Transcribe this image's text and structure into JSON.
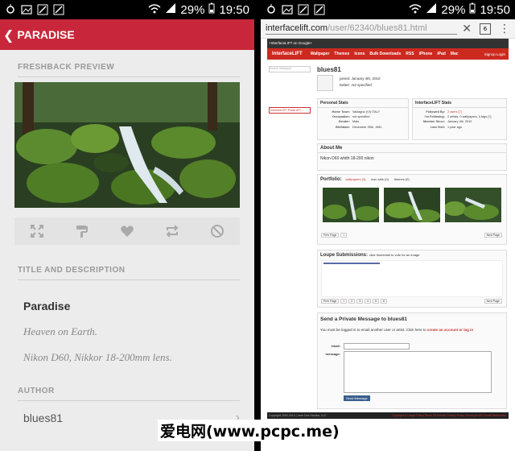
{
  "status": {
    "battery_pct": "29%",
    "time": "19:50"
  },
  "left": {
    "header": {
      "title": "PARADISE"
    },
    "preview_label": "FRESHBACK PREVIEW",
    "title_label": "TITLE AND DESCRIPTION",
    "title": "Paradise",
    "description1": "Heaven on Earth.",
    "description2": "Nikon D60, Nikkor 18-200mm lens.",
    "author_label": "AUTHOR",
    "author": "blues81",
    "accent_color": "#c8273b",
    "actions": [
      "expand-icon",
      "paint-roller-icon",
      "heart-icon",
      "repeat-icon",
      "block-icon"
    ]
  },
  "right": {
    "url_domain": "interfacelift.com",
    "url_path": "/user/62340/blues81.html",
    "tab_count": "6",
    "site": {
      "gbar": "+InterfaceLIFT on Google+",
      "logo": "InterfaceLIFT",
      "nav": [
        "Wallpaper",
        "Themes",
        "Icons",
        "Bulk Downloads",
        "RSS",
        "iPhone",
        "iPad",
        "Mac"
      ],
      "nav_right": "Signup  Login",
      "search_placeholder": "Search Wallpaper",
      "public_api": "InterfaceLIFT Public API →",
      "username": "blues81",
      "joined_label": "joined:",
      "joined": "January 4th, 2010",
      "twitter_label": "twitter:",
      "twitter": "not specified",
      "personal_stats_title": "Personal Stats",
      "personal_stats": [
        {
          "k": "Home Town:",
          "v": "Valdagno (VI) ITALY"
        },
        {
          "k": "Occupation:",
          "v": "not specified"
        },
        {
          "k": "Gender:",
          "v": "Male"
        },
        {
          "k": "Birthdate:",
          "v": "December 25th, 1981"
        }
      ],
      "il_stats_title": "InterfaceLIFT Stats",
      "il_stats": [
        {
          "k": "Followed By:",
          "v": "2 users [?]"
        },
        {
          "k": "I'm Following:",
          "v": "2 artists, 0 wallpapers, 0 tags [?]"
        },
        {
          "k": "Member Since:",
          "v": "January 4th, 2010"
        },
        {
          "k": "Last Visit:",
          "v": "1 year ago"
        }
      ],
      "about_title": "About Me",
      "about_text": "Nikon D60 whith 18-200 nikon",
      "portfolio_label": "Portfolio:",
      "portfolio_tabs": [
        "wallpapers (3)",
        "icon sets (0)",
        "themes (0)"
      ],
      "prev_page": "Prev Page",
      "next_page": "Next Page",
      "page1": "1",
      "loupe_title": "Loupe Submissions:",
      "loupe_hint": "click thumbnail to vote for an image",
      "loupe_pages": [
        "1",
        "2",
        "3",
        "4",
        "5",
        "6"
      ],
      "pm_title": "Send a Private Message to blues81",
      "pm_text": "You must be logged in to email another user or artist. Click here to",
      "pm_link": "create an account or log in",
      "email_label": "email:",
      "message_label": "message:",
      "send_button": "Send Message",
      "footer_left": "Copyright 2000-2014 | Jane Doe Studios, LLC",
      "footer_links": "Copyright & Usage Policy   Terms Of Service   Privacy Policy   Developer API   Email Webmaster"
    }
  },
  "watermark": "爱电网(www.pcpc.me)"
}
